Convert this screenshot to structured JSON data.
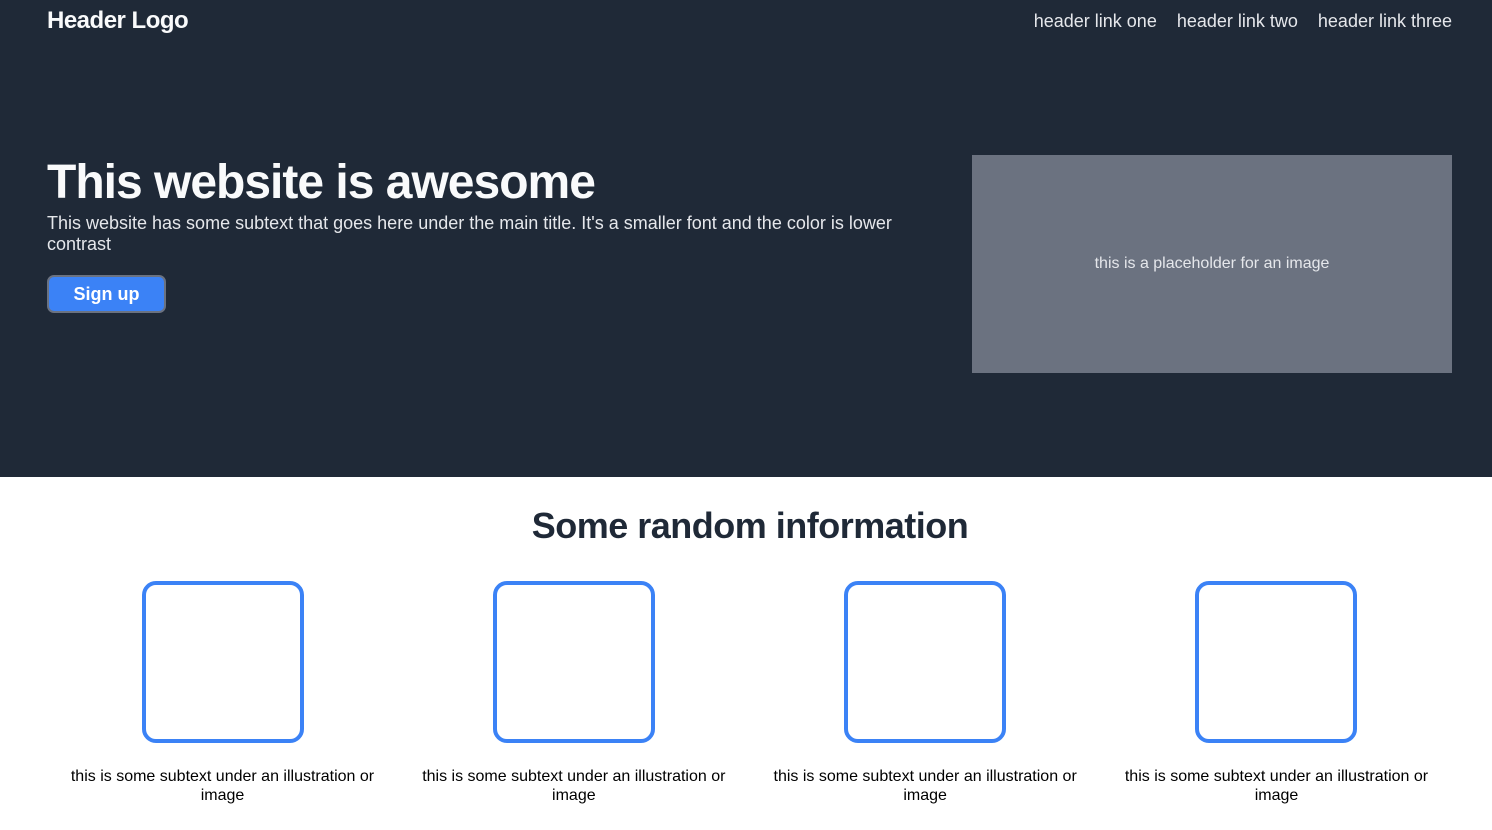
{
  "header": {
    "logo": "Header Logo",
    "links": [
      "header link one",
      "header link two",
      "header link three"
    ]
  },
  "hero": {
    "title": "This website is awesome",
    "subtitle": "This website has some subtext that goes here under the main title. It's a smaller font and the color is lower contrast",
    "button_label": "Sign up",
    "image_placeholder": "this is a placeholder for an image"
  },
  "info": {
    "title": "Some random information",
    "cards": [
      {
        "text": "this is some subtext under an illustration or image"
      },
      {
        "text": "this is some subtext under an illustration or image"
      },
      {
        "text": "this is some subtext under an illustration or image"
      },
      {
        "text": "this is some subtext under an illustration or image"
      }
    ]
  },
  "colors": {
    "dark_background": "#1f2937",
    "accent": "#3b82f6",
    "placeholder_gray": "#6b7280"
  }
}
